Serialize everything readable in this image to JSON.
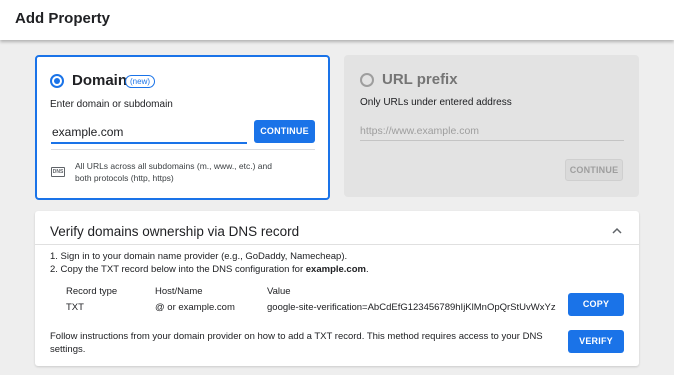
{
  "header": {
    "title": "Add Property"
  },
  "domain_card": {
    "title": "Domain",
    "badge": "(new)",
    "subtitle": "Enter domain or subdomain",
    "input_value": "example.com",
    "continue_label": "CONTINUE",
    "note": "All URLs across all subdomains (m., www., etc.) and both protocols (http, https)",
    "icon_text": "DNS",
    "selected": true
  },
  "url_card": {
    "title": "URL prefix",
    "subtitle": "Only URLs under entered address",
    "placeholder": "https://www.example.com",
    "continue_label": "CONTINUE",
    "selected": false
  },
  "verify": {
    "title": "Verify domains ownership via DNS record",
    "step1": "1. Sign in to your domain name provider (e.g., GoDaddy, Namecheap).",
    "step2_prefix": "2. Copy the TXT record below into the DNS configuration for ",
    "step2_domain": "example.com",
    "step2_suffix": ".",
    "columns": [
      "Record type",
      "Host/Name",
      "Value"
    ],
    "record": {
      "type": "TXT",
      "host": "@ or example.com",
      "value": "google-site-verification=AbCdEfG123456789hIjKlMnOpQrStUvWxYz"
    },
    "copy_label": "COPY",
    "follow_text": "Follow instructions from your domain provider on how to add a TXT record. This method requires access to your DNS settings.",
    "verify_label": "VERIFY"
  },
  "colors": {
    "accent": "#1a73e8",
    "background": "#eeeeee",
    "disabled_card": "#e3e3e3"
  }
}
